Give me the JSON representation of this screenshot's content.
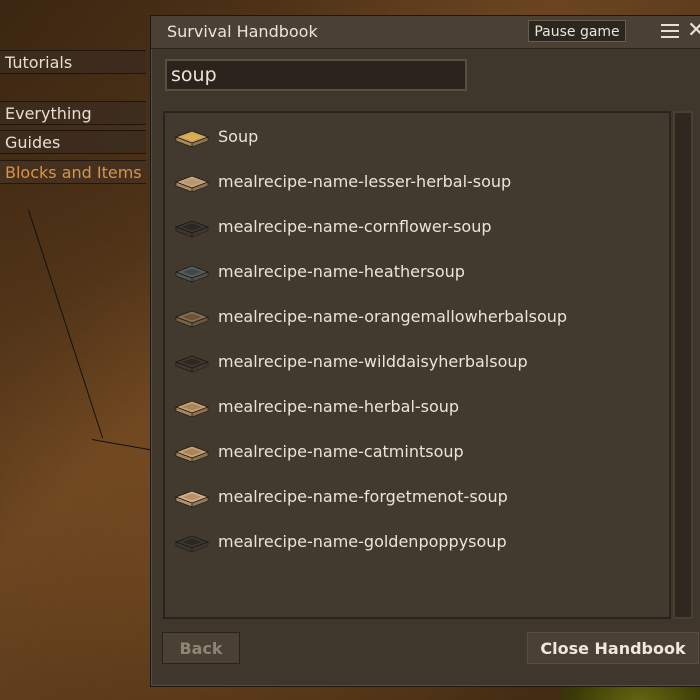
{
  "sidebar": {
    "tabs": [
      {
        "label": "Tutorials",
        "active": false
      },
      {
        "label": "Everything",
        "active": false
      },
      {
        "label": "Guides",
        "active": false
      },
      {
        "label": "Blocks and Items",
        "active": true
      }
    ]
  },
  "window": {
    "title": "Survival Handbook",
    "pause_label": "Pause game",
    "menu_icon": "hamburger-menu-icon",
    "close_icon": "close-icon"
  },
  "search": {
    "value": "soup"
  },
  "results": [
    {
      "label": "Soup",
      "icon": "bowl-icon",
      "color": "#c9a46a",
      "fill": "#d9b04a"
    },
    {
      "label": "mealrecipe-name-lesser-herbal-soup",
      "icon": "bowl-icon",
      "color": "#c8a27a",
      "fill": "#b89870"
    },
    {
      "label": "mealrecipe-name-cornflower-soup",
      "icon": "bowl-icon",
      "color": "#3a3530",
      "fill": "#2a2622"
    },
    {
      "label": "mealrecipe-name-heathersoup",
      "icon": "bowl-icon",
      "color": "#5a6060",
      "fill": "#404848"
    },
    {
      "label": "mealrecipe-name-orangemallowherbalsoup",
      "icon": "bowl-icon",
      "color": "#8a7050",
      "fill": "#6a5538"
    },
    {
      "label": "mealrecipe-name-wilddaisyherbalsoup",
      "icon": "bowl-icon",
      "color": "#403830",
      "fill": "#2e2822"
    },
    {
      "label": "mealrecipe-name-herbal-soup",
      "icon": "bowl-icon",
      "color": "#c8a070",
      "fill": "#a88558"
    },
    {
      "label": "mealrecipe-name-catmintsoup",
      "icon": "bowl-icon",
      "color": "#c8a070",
      "fill": "#a88558"
    },
    {
      "label": "mealrecipe-name-forgetmenot-soup",
      "icon": "bowl-icon",
      "color": "#d4b088",
      "fill": "#b89070"
    },
    {
      "label": "mealrecipe-name-goldenpoppysoup",
      "icon": "bowl-icon",
      "color": "#3a3632",
      "fill": "#2a2724"
    }
  ],
  "footer": {
    "back_label": "Back",
    "close_label": "Close Handbook"
  }
}
